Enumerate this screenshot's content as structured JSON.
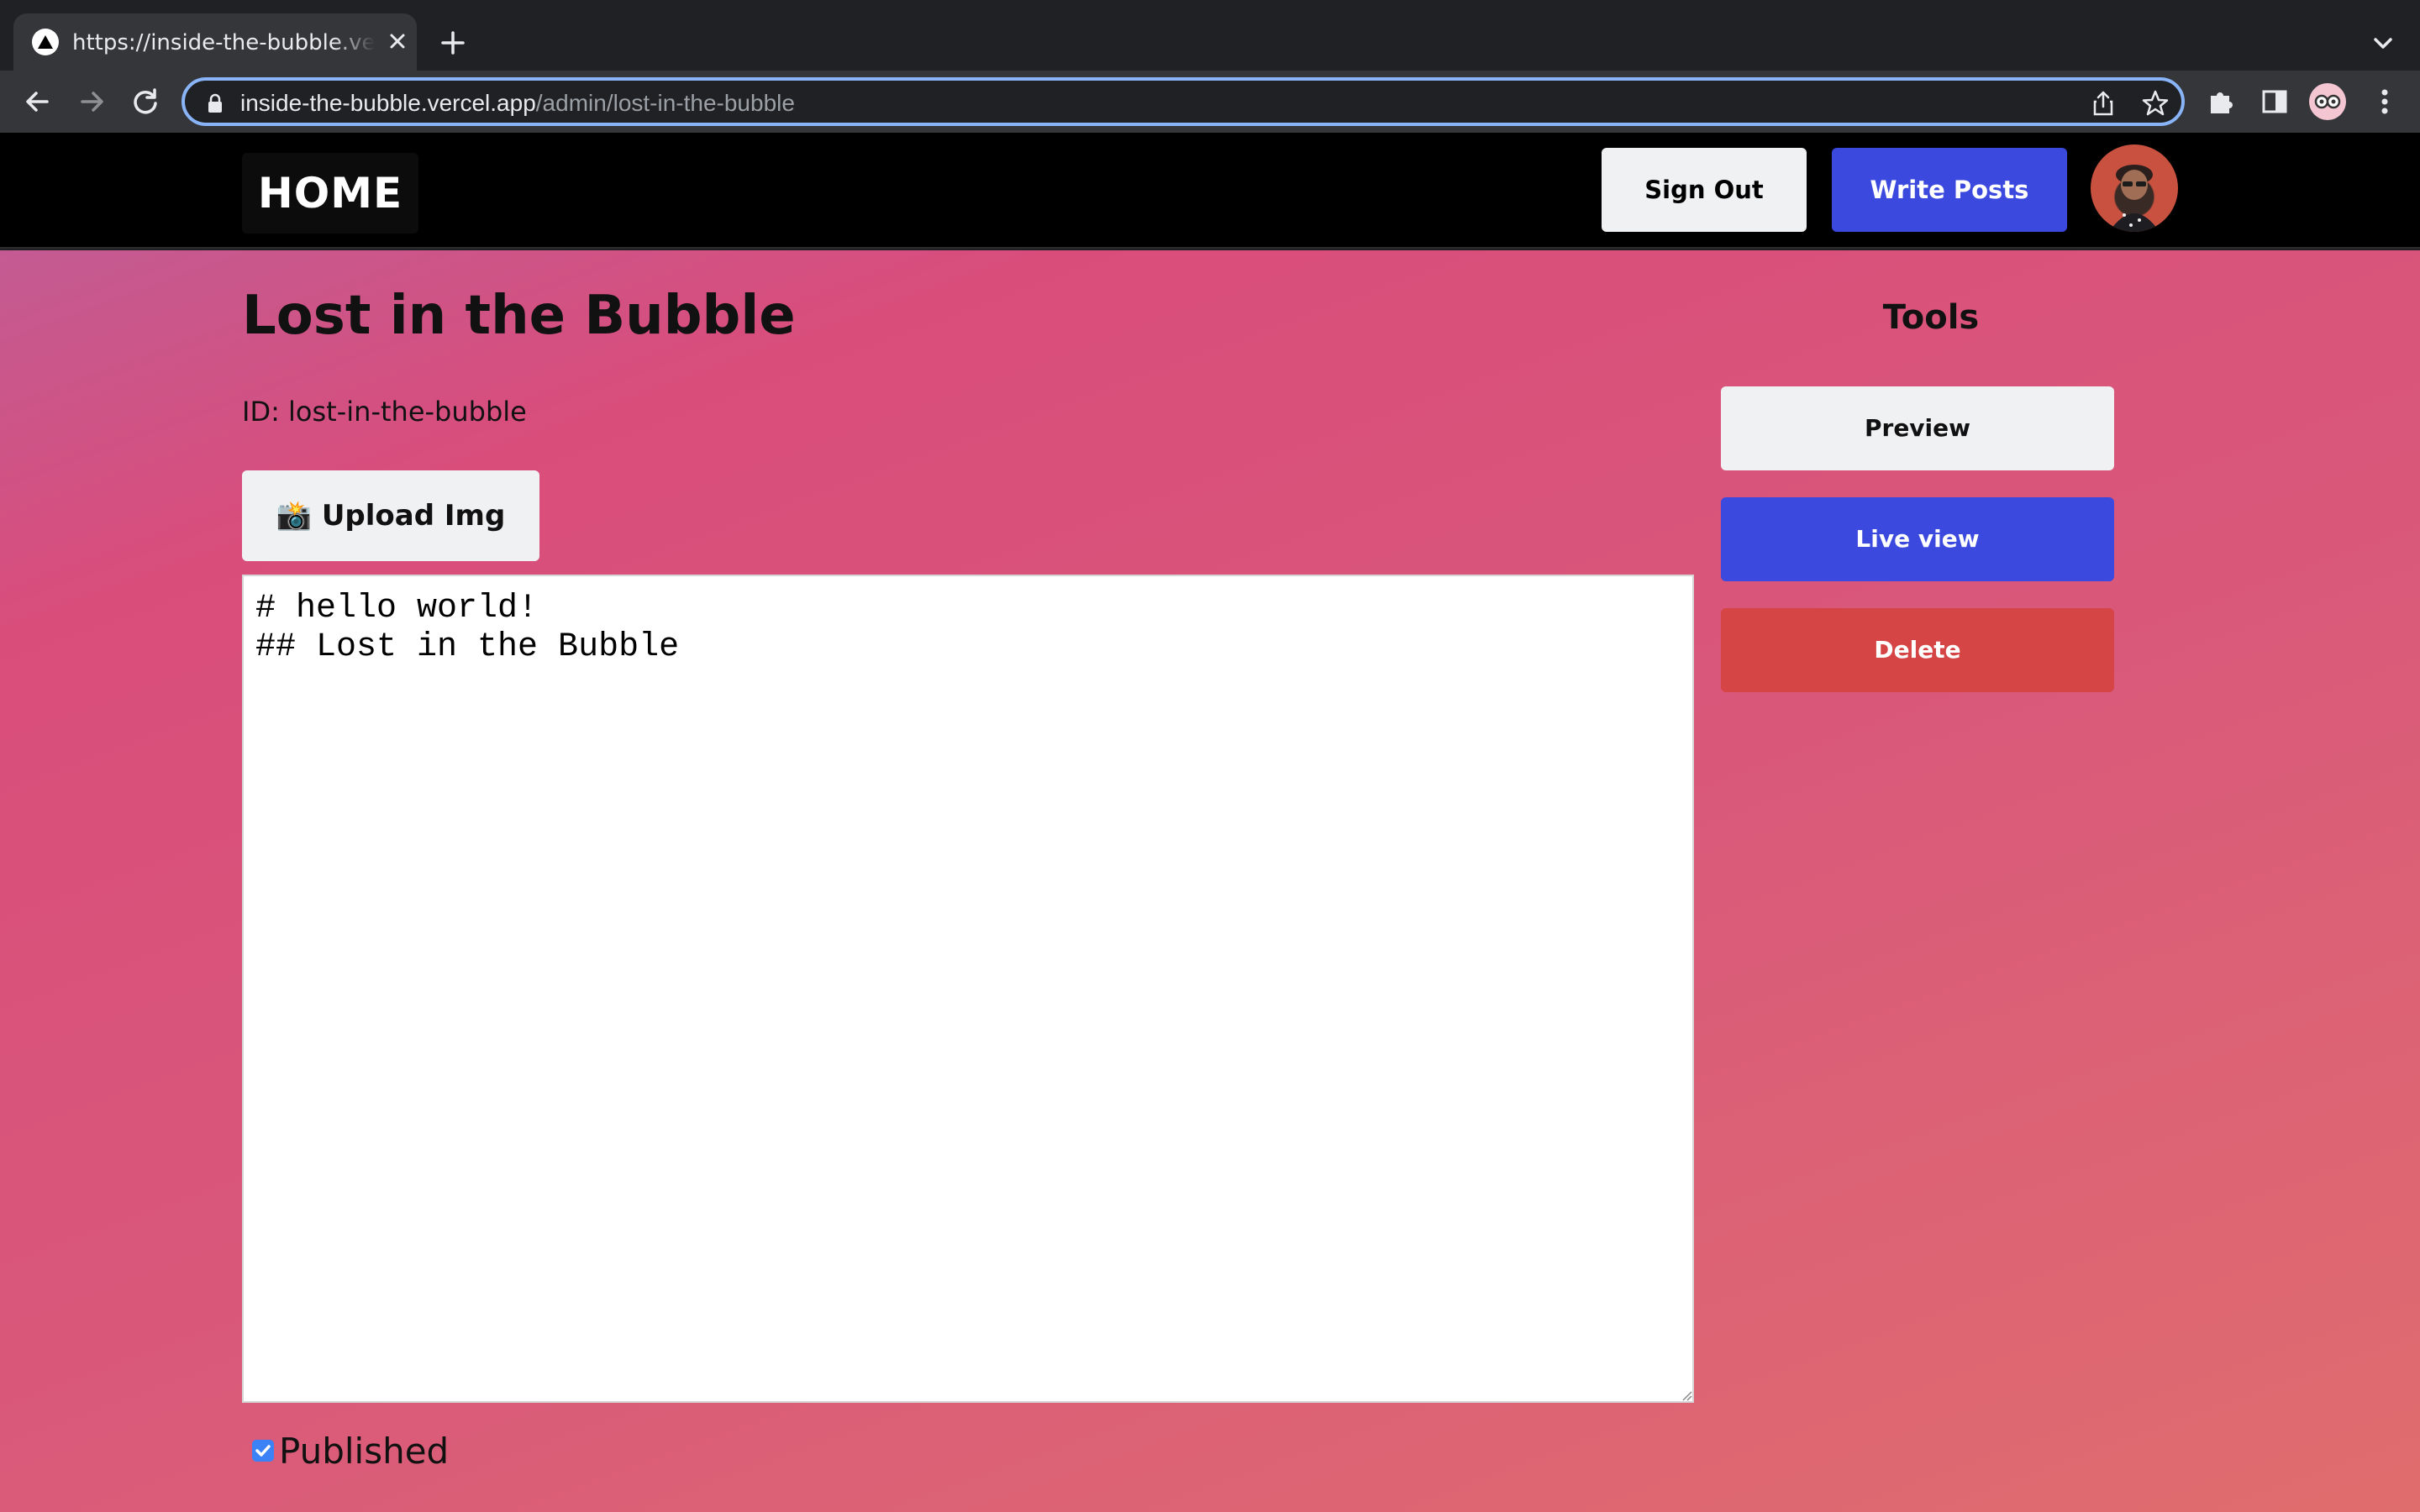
{
  "browser": {
    "tab_title": "https://inside-the-bubble.vercel.app/admin/lost-in-the-bubble",
    "url_host": "inside-the-bubble.vercel.app",
    "url_path": "/admin/lost-in-the-bubble"
  },
  "header": {
    "home_label": "HOME",
    "signout_label": "Sign Out",
    "write_label": "Write Posts"
  },
  "post": {
    "title": "Lost in the Bubble",
    "id_text": "ID: lost-in-the-bubble",
    "upload_label": "📸 Upload Img",
    "content": "# hello world!\n## Lost in the Bubble",
    "published_label": "Published",
    "published": true
  },
  "tools": {
    "title": "Tools",
    "preview_label": "Preview",
    "live_label": "Live view",
    "delete_label": "Delete"
  },
  "colors": {
    "accent_blue": "#3b49df",
    "danger_red": "#d64545",
    "focus_ring": "#8ab4f8"
  }
}
